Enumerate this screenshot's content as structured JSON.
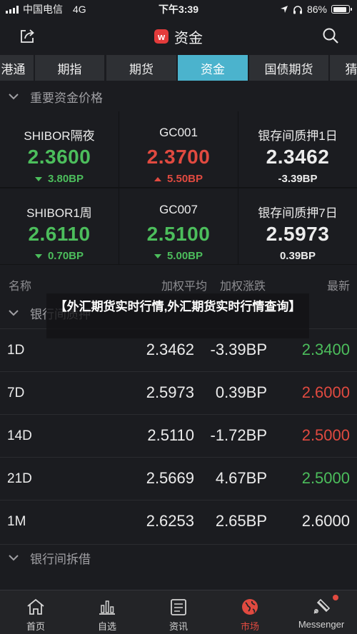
{
  "status_bar": {
    "carrier": "中国电信",
    "network": "4G",
    "time": "下午3:39",
    "battery_text": "86%",
    "battery_level": 0.86
  },
  "nav": {
    "logo_letter": "w",
    "title": "资金"
  },
  "tabs": [
    "港通",
    "期指",
    "期货",
    "资金",
    "国债期货",
    "猜"
  ],
  "active_tab": "资金",
  "section_main": "重要资金价格",
  "cards": [
    {
      "name": "SHIBOR隔夜",
      "value": "2.3600",
      "change": "3.80BP",
      "direction": "down"
    },
    {
      "name": "GC001",
      "value": "2.3700",
      "change": "5.50BP",
      "direction": "up"
    },
    {
      "name": "银存间质押1日",
      "value": "2.3462",
      "change": "-3.39BP",
      "direction": "flat"
    },
    {
      "name": "SHIBOR1周",
      "value": "2.6110",
      "change": "0.70BP",
      "direction": "down"
    },
    {
      "name": "GC007",
      "value": "2.5100",
      "change": "5.00BP",
      "direction": "down"
    },
    {
      "name": "银存间质押7日",
      "value": "2.5973",
      "change": "0.39BP",
      "direction": "flat"
    }
  ],
  "columns": {
    "name": "名称",
    "avg": "加权平均",
    "chg": "加权涨跌",
    "latest": "最新"
  },
  "section_pledge": "银行间质押",
  "rows": [
    {
      "tenor": "1D",
      "avg": "2.3462",
      "chg": "-3.39BP",
      "latest": "2.3400",
      "latest_dir": "down"
    },
    {
      "tenor": "7D",
      "avg": "2.5973",
      "chg": "0.39BP",
      "latest": "2.6000",
      "latest_dir": "up"
    },
    {
      "tenor": "14D",
      "avg": "2.5110",
      "chg": "-1.72BP",
      "latest": "2.5000",
      "latest_dir": "up"
    },
    {
      "tenor": "21D",
      "avg": "2.5669",
      "chg": "4.67BP",
      "latest": "2.5000",
      "latest_dir": "down"
    },
    {
      "tenor": "1M",
      "avg": "2.6253",
      "chg": "2.65BP",
      "latest": "2.6000",
      "latest_dir": "flat"
    }
  ],
  "section_lending": "银行间拆借",
  "overlay_text": "【外汇期货实时行情,外汇期货实时行情查询】",
  "bottom_nav": [
    {
      "label": "首页",
      "icon": "home-icon"
    },
    {
      "label": "自选",
      "icon": "chart-icon"
    },
    {
      "label": "资讯",
      "icon": "news-icon"
    },
    {
      "label": "市场",
      "icon": "globe-icon",
      "active": true
    },
    {
      "label": "Messenger",
      "icon": "messenger-icon"
    }
  ],
  "colors": {
    "up": "#e14a40",
    "down": "#4cbe5c",
    "active_tab": "#4bb3cd",
    "background": "#1b1c20"
  }
}
